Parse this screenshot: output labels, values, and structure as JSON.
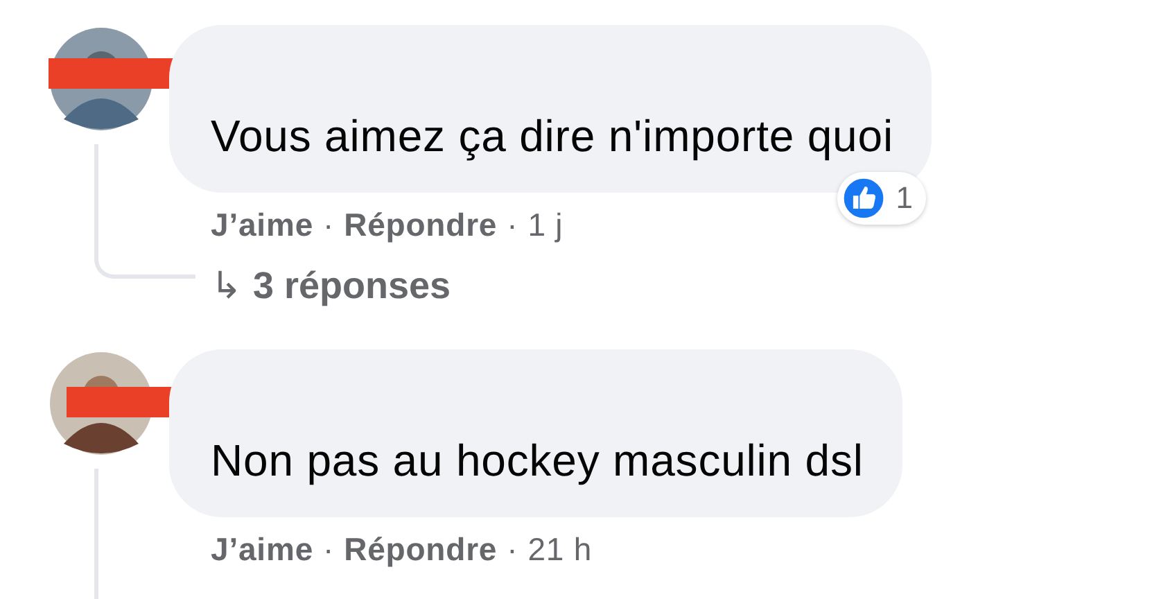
{
  "comments": [
    {
      "text": "Vous aimez ça dire n'importe quoi",
      "like": "J’aime",
      "sep1": "·",
      "reply": "Répondre",
      "sep2": "·",
      "time": "1 j",
      "reaction_count": "1",
      "replies_arrow": "↳",
      "replies_label": "3 réponses"
    },
    {
      "text": "Non pas au hockey masculin dsl",
      "like": "J’aime",
      "sep1": "·",
      "reply": "Répondre",
      "sep2": "·",
      "time": "21 h"
    }
  ]
}
